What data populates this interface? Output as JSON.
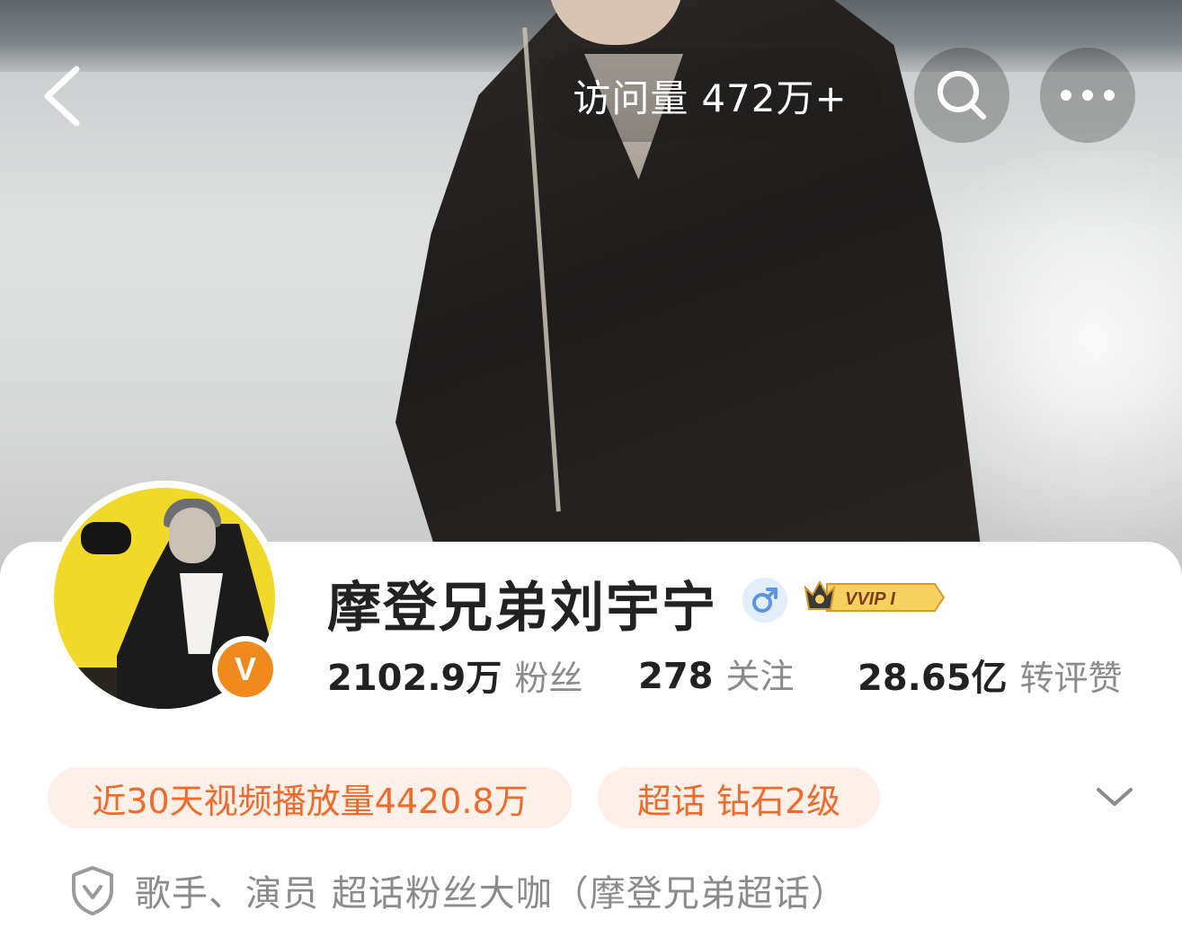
{
  "header": {
    "back_icon": "chevron-left-icon",
    "visit_label": "访问量",
    "visit_count": "472万+",
    "search_icon": "search-icon",
    "more_icon": "more-dots-icon"
  },
  "profile": {
    "username": "摩登兄弟刘宇宁",
    "gender_icon": "male-icon",
    "verified_badge": "V",
    "vip_badge": "VVIP I",
    "colors": {
      "accent_orange": "#f06a2b",
      "tag_background": "#fdf0e8",
      "verified_orange": "#f08a1c",
      "vip_gold": "#f3c445",
      "male_blue": "#5a96e6"
    }
  },
  "stats": [
    {
      "value": "2102.9万",
      "label": "粉丝"
    },
    {
      "value": "278",
      "label": "关注"
    },
    {
      "value": "28.65亿",
      "label": "转评赞"
    }
  ],
  "tags": {
    "video_plays": "近30天视频播放量4420.8万",
    "supertopic": "超话 钻石2级"
  },
  "bio": {
    "icon": "shield-check-icon",
    "text": "歌手、演员 超话粉丝大咖（摩登兄弟超话）"
  }
}
